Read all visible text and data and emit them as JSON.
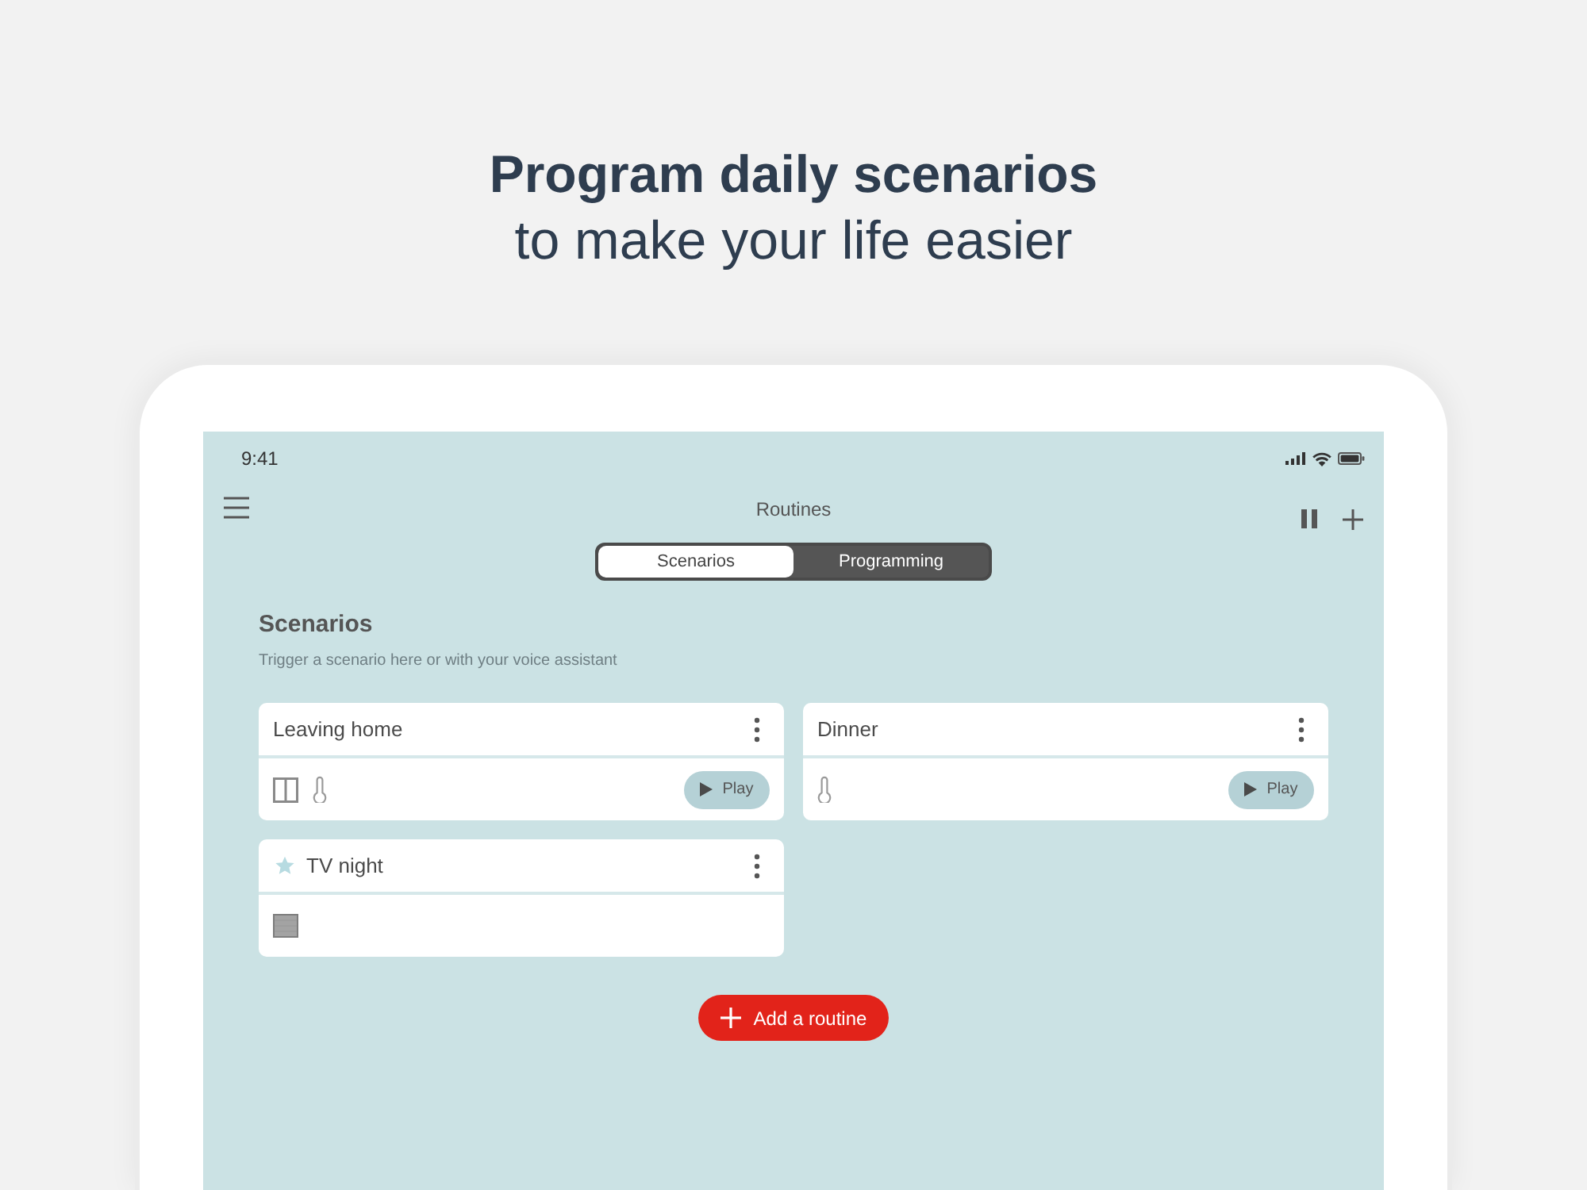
{
  "headline": {
    "title": "Program daily scenarios",
    "subtitle": "to make your life easier"
  },
  "status_bar": {
    "time": "9:41"
  },
  "nav_bar": {
    "title": "Routines"
  },
  "tabs": [
    {
      "label": "Scenarios",
      "selected": true
    },
    {
      "label": "Programming",
      "selected": false
    }
  ],
  "section": {
    "title": "Scenarios",
    "description": "Trigger a scenario here or with your voice assistant"
  },
  "scenarios": [
    {
      "name": "Leaving home",
      "favorite": false,
      "devices": [
        {
          "kind": "window"
        },
        {
          "kind": "thermometer"
        }
      ],
      "play": "Play"
    },
    {
      "name": "Dinner",
      "favorite": false,
      "devices": [
        {
          "kind": "thermometer"
        }
      ],
      "play": "Play"
    },
    {
      "name": "TV night",
      "favorite": true,
      "devices": [
        {
          "kind": "blind"
        }
      ]
    }
  ],
  "add_button": {
    "label": "Add a routine"
  }
}
